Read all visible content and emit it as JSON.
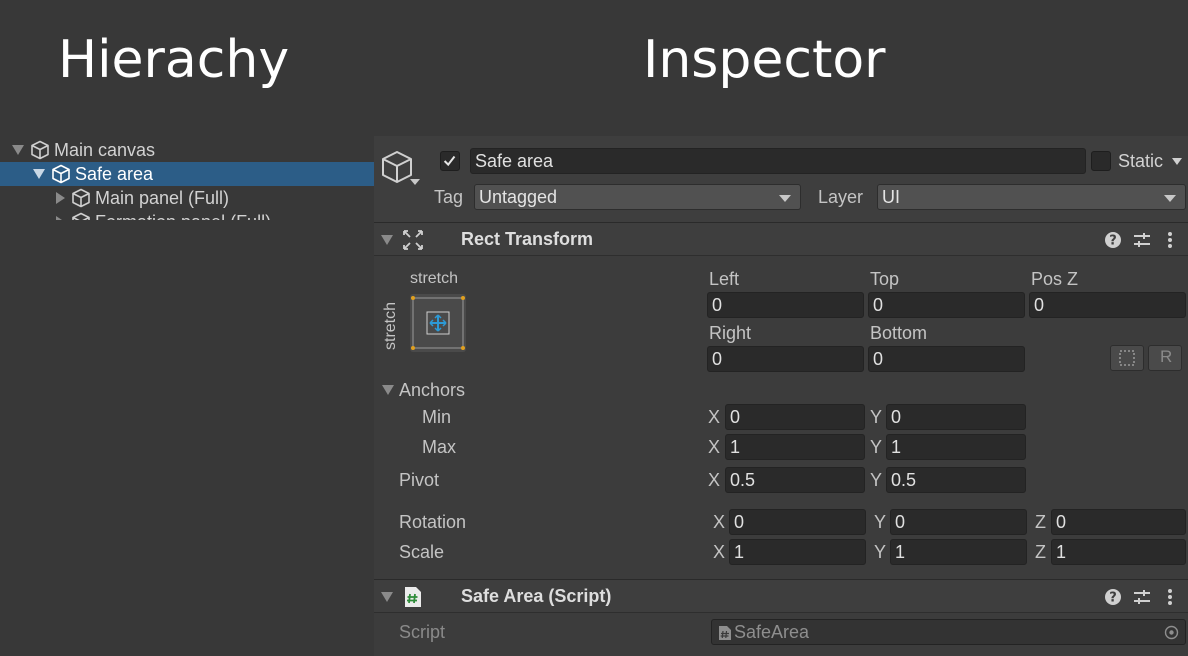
{
  "titles": {
    "hierarchy": "Hierachy",
    "inspector": "Inspector"
  },
  "hierarchy": {
    "items": [
      {
        "label": "Main canvas",
        "expanded": true,
        "selected": false
      },
      {
        "label": "Safe area",
        "expanded": true,
        "selected": true
      },
      {
        "label": "Main panel (Full)",
        "expanded": false,
        "selected": false
      },
      {
        "label": "Formation panel (Full)",
        "expanded": false,
        "selected": false
      }
    ]
  },
  "header": {
    "active": true,
    "name": "Safe area",
    "static_label": "Static",
    "tag_label": "Tag",
    "tag_value": "Untagged",
    "layer_label": "Layer",
    "layer_value": "UI"
  },
  "rect_transform": {
    "title": "Rect Transform",
    "preset_top": "stretch",
    "preset_side": "stretch",
    "cols": [
      "Left",
      "Top",
      "Pos Z"
    ],
    "row1": [
      "0",
      "0",
      "0"
    ],
    "cols2": [
      "Right",
      "Bottom"
    ],
    "row2": [
      "0",
      "0"
    ],
    "anchors_label": "Anchors",
    "min_label": "Min",
    "min": {
      "x": "0",
      "y": "0"
    },
    "max_label": "Max",
    "max": {
      "x": "1",
      "y": "1"
    },
    "pivot_label": "Pivot",
    "pivot": {
      "x": "0.5",
      "y": "0.5"
    },
    "rotation_label": "Rotation",
    "rotation": {
      "x": "0",
      "y": "0",
      "z": "0"
    },
    "scale_label": "Scale",
    "scale": {
      "x": "1",
      "y": "1",
      "z": "1"
    },
    "axis_x": "X",
    "axis_y": "Y",
    "axis_z": "Z",
    "blueprint_btn": "R"
  },
  "script_component": {
    "title": "Safe Area (Script)",
    "script_label": "Script",
    "script_value": "SafeArea"
  },
  "colors": {
    "selection": "#2c5d87",
    "background": "#383838",
    "panel": "#3c3c3c",
    "field": "#2a2a2a"
  }
}
